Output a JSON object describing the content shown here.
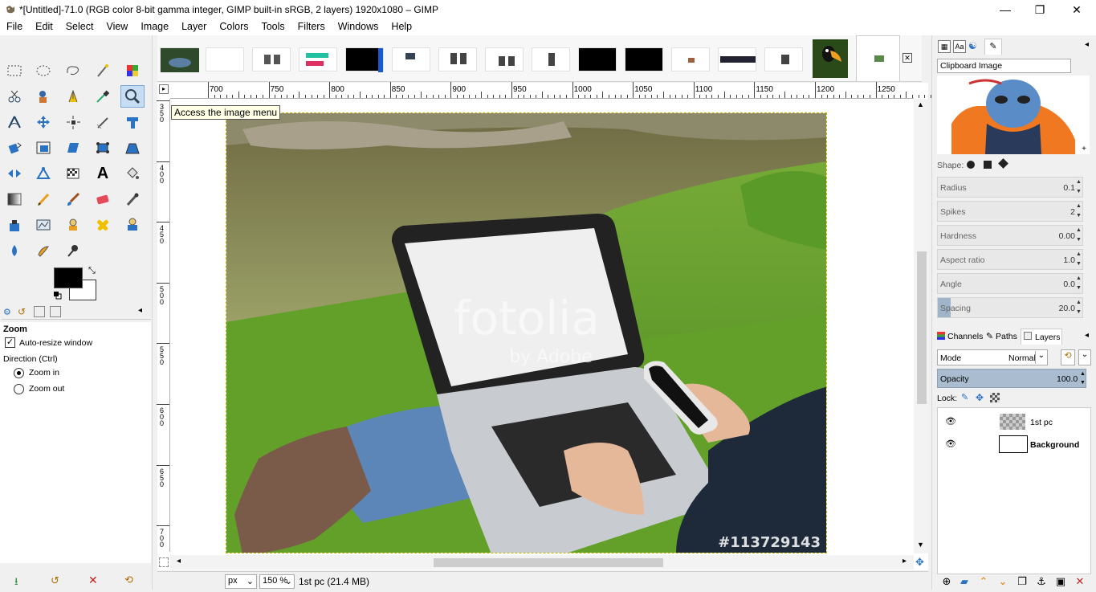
{
  "window": {
    "title": "*[Untitled]-71.0 (RGB color 8-bit gamma integer, GIMP built-in sRGB, 2 layers) 1920x1080 – GIMP",
    "minimize": "—",
    "restore": "❐",
    "close": "✕"
  },
  "menu": [
    "File",
    "Edit",
    "Select",
    "View",
    "Image",
    "Layer",
    "Colors",
    "Tools",
    "Filters",
    "Windows",
    "Help"
  ],
  "tooltip": "Access the image menu",
  "ruler": {
    "labels": [
      "700",
      "750",
      "800",
      "850",
      "900",
      "950",
      "1000",
      "1050",
      "1100",
      "1150",
      "1200",
      "1250"
    ],
    "vlabels": [
      "3\n5\n0",
      "4\n0\n0",
      "4\n5\n0",
      "5\n0\n0",
      "5\n5\n0",
      "6\n0\n0",
      "6\n5\n0",
      "7\n0\n0"
    ]
  },
  "photo": {
    "watermark": "fotolia",
    "watermark_sub": "by Adobe",
    "stock_id": "#113729143"
  },
  "tool_options": {
    "title": "Zoom",
    "auto_resize": "Auto-resize window",
    "direction": "Direction  (Ctrl)",
    "zoom_in": "Zoom in",
    "zoom_out": "Zoom out"
  },
  "status": {
    "unit": "px",
    "zoom": "150 %",
    "layer_info": "1st pc (21.4 MB)"
  },
  "brushes": {
    "name": "Clipboard Image",
    "shape_label": "Shape:",
    "fields": [
      {
        "label": "Radius",
        "value": "0.1"
      },
      {
        "label": "Spikes",
        "value": "2"
      },
      {
        "label": "Hardness",
        "value": "0.00"
      },
      {
        "label": "Aspect ratio",
        "value": "1.0"
      },
      {
        "label": "Angle",
        "value": "0.0"
      },
      {
        "label": "Spacing",
        "value": "20.0"
      }
    ]
  },
  "layers_panel": {
    "tabs": [
      "Channels",
      "Paths",
      "Layers"
    ],
    "mode_label": "Mode",
    "mode_value": "Normal",
    "opacity_label": "Opacity",
    "opacity_value": "100.0",
    "lock_label": "Lock:",
    "layers": [
      {
        "name": "1st pc"
      },
      {
        "name": "Background"
      }
    ]
  },
  "colors": {
    "accent": "#c6ddf3",
    "selection": "#c8b400"
  }
}
